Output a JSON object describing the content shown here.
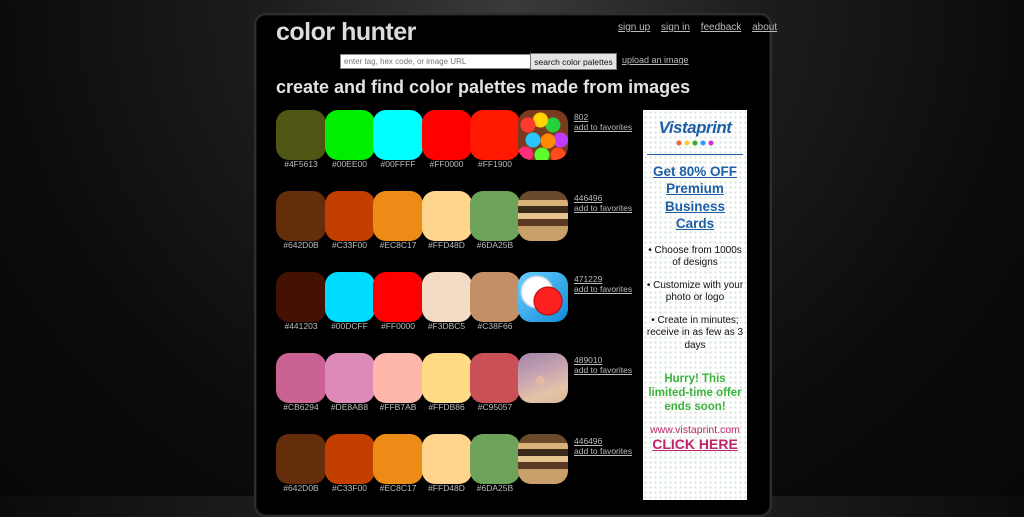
{
  "header": {
    "logo": "color hunter",
    "links": [
      "sign up",
      "sign in",
      "feedback",
      "about"
    ]
  },
  "search": {
    "placeholder": "enter tag, hex code, or image URL",
    "button_label": "search color palettes",
    "upload_label": "upload an image"
  },
  "headline": "create and find color palettes made from images",
  "palettes": [
    {
      "id": "802",
      "favorites_label": "add to favorites",
      "thumb": "candy-photo",
      "colors": [
        "#4F5613",
        "#00EE00",
        "#00FFFF",
        "#FF0000",
        "#FF1900"
      ]
    },
    {
      "id": "446496",
      "favorites_label": "add to favorites",
      "thumb": "shop-photo",
      "colors": [
        "#642D0B",
        "#C33F00",
        "#EC8C17",
        "#FFD48D",
        "#6DA25B"
      ]
    },
    {
      "id": "471229",
      "favorites_label": "add to favorites",
      "thumb": "ball-photo",
      "colors": [
        "#441203",
        "#00DCFF",
        "#FF0000",
        "#F3DBC5",
        "#C38F66"
      ]
    },
    {
      "id": "489010",
      "favorites_label": "add to favorites",
      "thumb": "bird-photo",
      "colors": [
        "#CB6294",
        "#DE8AB8",
        "#FFB7AB",
        "#FFDB86",
        "#C95057"
      ]
    },
    {
      "id": "446496",
      "favorites_label": "add to favorites",
      "thumb": "shop-photo",
      "colors": [
        "#642D0B",
        "#C33F00",
        "#EC8C17",
        "#FFD48D",
        "#6DA25B"
      ]
    }
  ],
  "ad": {
    "logo": "Vistaprint",
    "offer": "Get 80% OFF",
    "offer_sub": "Premium Business Cards",
    "bullets": [
      "• Choose from 1000s of designs",
      "• Customize with your photo or logo",
      "• Create in minutes; receive in as few as 3 days"
    ],
    "hurry": "Hurry! This limited-time offer ends soon!",
    "url": "www.vistaprint.com",
    "cta": "CLICK HERE"
  }
}
